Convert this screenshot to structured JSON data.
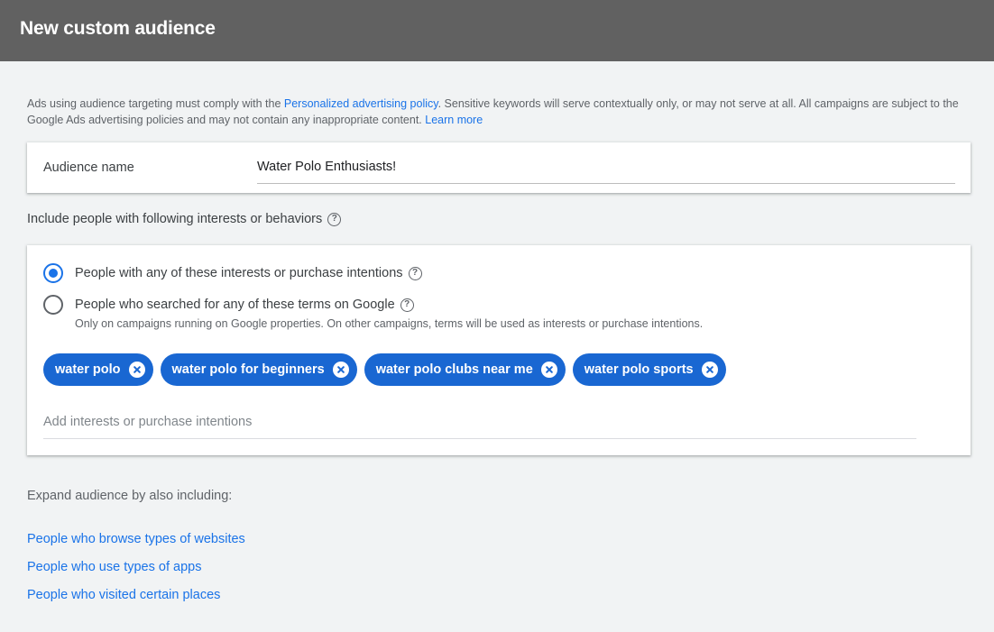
{
  "header": {
    "title": "New custom audience"
  },
  "notice": {
    "text_1": "Ads using audience targeting must comply with the ",
    "policy_link": "Personalized advertising policy",
    "text_2": ". Sensitive keywords will serve contextually only, or may not serve at all. All campaigns are subject to the Google Ads advertising policies and may not contain any inappropriate content. ",
    "learn_more": "Learn more"
  },
  "audience_name": {
    "label": "Audience name",
    "value": "Water Polo Enthusiasts!"
  },
  "include": {
    "title": "Include people with following interests or behaviors",
    "help_icon": "help-circle-icon",
    "options": [
      {
        "label": "People with any of these interests or purchase intentions",
        "selected": true
      },
      {
        "label": "People who searched for any of these terms on Google",
        "selected": false
      }
    ],
    "search_note": "Only on campaigns running on Google properties. On other campaigns, terms will be used as interests or purchase intentions.",
    "chips": [
      "water polo",
      "water polo for beginners",
      "water polo clubs near me",
      "water polo sports"
    ],
    "chip_remove_icon": "close-circle-icon",
    "add_placeholder": "Add interests or purchase intentions"
  },
  "expand": {
    "title": "Expand audience by also including:",
    "links": [
      "People who browse types of websites",
      "People who use types of apps",
      "People who visited certain places"
    ]
  },
  "colors": {
    "header_bg": "#616161",
    "accent": "#1a73e8",
    "chip_bg": "#1967d2",
    "page_bg": "#f1f3f4"
  }
}
